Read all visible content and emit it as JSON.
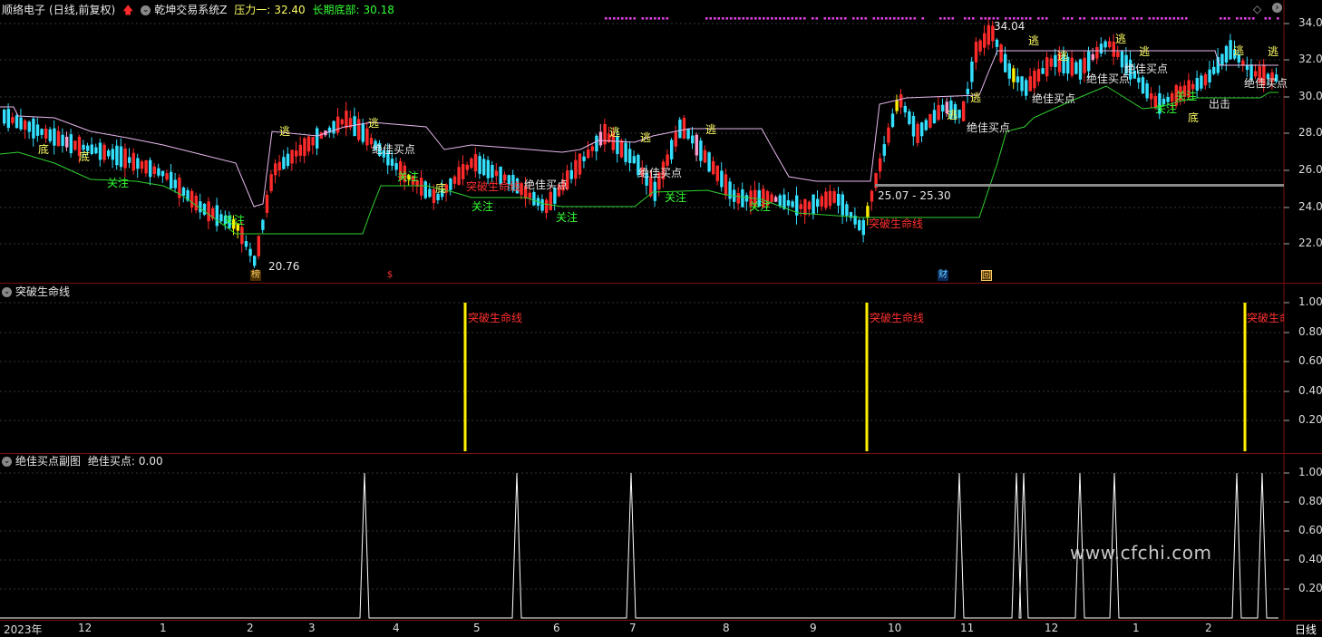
{
  "main_header": {
    "stock_name": "顺络电子",
    "period": "(日线,前复权)",
    "indicator": "乾坤交易系统Z",
    "pressure_label": "压力一:",
    "pressure_value": "32.40",
    "bottom_label": "长期底部:",
    "bottom_value": "30.18"
  },
  "main_yaxis": [
    "34.00",
    "32.00",
    "30.00",
    "28.00",
    "26.00",
    "24.00",
    "22.00"
  ],
  "sub1_header": {
    "title": "突破生命线"
  },
  "sub1_yaxis": [
    "1.00",
    "0.80",
    "0.60",
    "0.40",
    "0.20"
  ],
  "sub2_header": {
    "title": "绝佳买点副图",
    "value_label": "绝佳买点:",
    "value": "0.00"
  },
  "sub2_yaxis": [
    "1.00",
    "0.80",
    "0.60",
    "0.40",
    "0.20"
  ],
  "time_axis": [
    "2023年",
    "12",
    "1",
    "2",
    "3",
    "4",
    "5",
    "6",
    "7",
    "8",
    "9",
    "10",
    "11",
    "12",
    "1",
    "2"
  ],
  "period_button": "日线",
  "annotations": {
    "max_price": "34.04",
    "min_price": "20.76",
    "range_label": "25.07 - 25.30",
    "buy_point": "绝佳买点",
    "breakout": "突破生命线",
    "escape": "逃",
    "watch": "关注",
    "bottom": "底",
    "out": "出击",
    "bang": "榜",
    "cai": "财",
    "hui": "回",
    "s": "$"
  },
  "sub1_marker_label": "突破生命线",
  "watermark": "www.cfchi.com",
  "colors": {
    "up": "#ff2a2a",
    "down": "#33e0ff",
    "yellow_bar": "#ffee00",
    "pink": "#ff99cc",
    "resistance_line": "#e8b7ee",
    "support_line": "#2fd12f",
    "magenta_dots": "#e040e0"
  }
}
